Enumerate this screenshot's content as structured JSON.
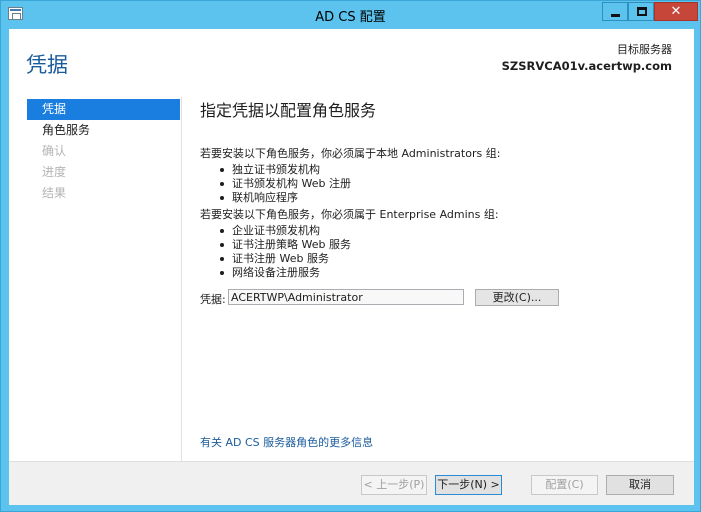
{
  "window": {
    "title": "AD CS 配置",
    "close_glyph": "✕"
  },
  "page": {
    "title": "凭据",
    "target_server_label": "目标服务器",
    "target_server_name": "SZSRVCA01v.acertwp.com"
  },
  "nav": {
    "items": [
      {
        "label": "凭据",
        "state": "active"
      },
      {
        "label": "角色服务",
        "state": "enabled"
      },
      {
        "label": "确认",
        "state": "disabled"
      },
      {
        "label": "进度",
        "state": "disabled"
      },
      {
        "label": "结果",
        "state": "disabled"
      }
    ]
  },
  "content": {
    "heading": "指定凭据以配置角色服务",
    "local_admin_intro": "若要安装以下角色服务，你必须属于本地 Administrators 组:",
    "local_admin_services": [
      "独立证书颁发机构",
      "证书颁发机构 Web 注册",
      "联机响应程序"
    ],
    "enterprise_admin_intro": "若要安装以下角色服务，你必须属于 Enterprise Admins 组:",
    "enterprise_admin_services": [
      "企业证书颁发机构",
      "证书注册策略 Web 服务",
      "证书注册 Web 服务",
      "网络设备注册服务"
    ],
    "credentials_label": "凭据:",
    "credentials_value": "ACERTWP\\Administrator",
    "change_button": "更改(C)...",
    "more_info_link": "有关 AD CS 服务器角色的更多信息"
  },
  "footer": {
    "prev_button": "< 上一步(P)",
    "next_button": "下一步(N) >",
    "configure_button": "配置(C)",
    "cancel_button": "取消"
  },
  "colors": {
    "window_frame": "#5bc3ee",
    "close_button": "#c7463a",
    "nav_active": "#1a7ee0",
    "title_text": "#1a5b9c",
    "link": "#1a5b9c"
  }
}
